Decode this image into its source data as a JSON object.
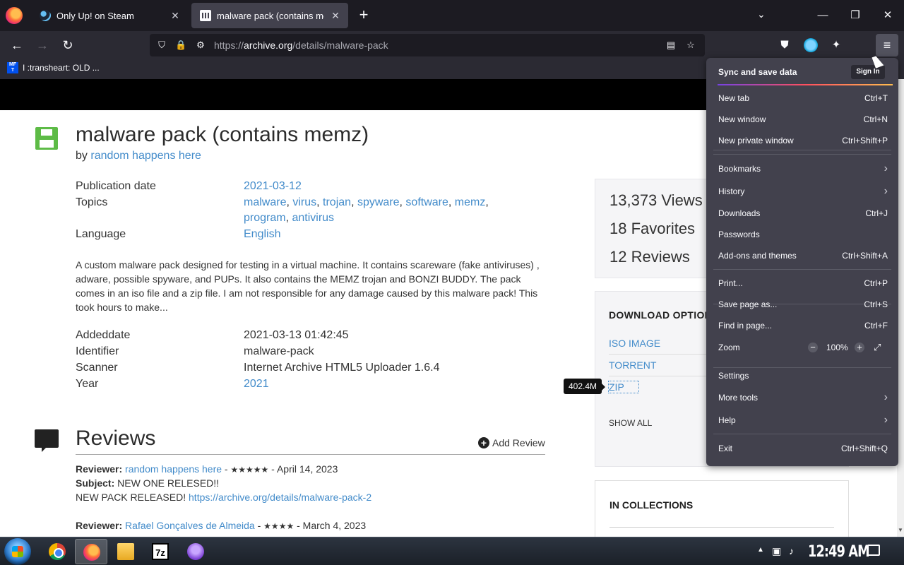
{
  "browser": {
    "tabs": [
      {
        "title": "Only Up! on Steam",
        "active": false
      },
      {
        "title": "malware pack (contains memz)",
        "active": true
      }
    ],
    "close_glyph": "✕",
    "url_prefix": "https://",
    "url_domain": "archive.org",
    "url_path": "/details/malware-pack",
    "bookmark": {
      "label": "I :transheart: OLD ...",
      "icon_text": "MF T"
    }
  },
  "item": {
    "title": "malware pack (contains memz)",
    "by_label": "by",
    "author": "random happens here",
    "publication_date_label": "Publication date",
    "publication_date": "2021-03-12",
    "topics_label": "Topics",
    "topics_line1": [
      {
        "text": "malware",
        "sep": ", "
      },
      {
        "text": "virus",
        "sep": ", "
      },
      {
        "text": "trojan",
        "sep": ", "
      },
      {
        "text": "spyware",
        "sep": ", "
      },
      {
        "text": "software",
        "sep": ", "
      },
      {
        "text": "memz",
        "sep": ","
      }
    ],
    "topics_line2": [
      {
        "text": "program",
        "sep": ", "
      },
      {
        "text": "antivirus",
        "sep": ""
      }
    ],
    "language_label": "Language",
    "language": "English",
    "description": "A custom malware pack designed for testing in a virtual machine. It contains scareware (fake antiviruses) , adware, possible spyware, and PUPs. It also contains the MEMZ trojan and BONZI BUDDY. The pack comes in an iso file and a zip file. I am not responsible for any damage caused by this malware pack! This took hours to make...",
    "addeddate_label": "Addeddate",
    "addeddate": "2021-03-13 01:42:45",
    "identifier_label": "Identifier",
    "identifier": "malware-pack",
    "scanner_label": "Scanner",
    "scanner": "Internet Archive HTML5 Uploader 1.6.4",
    "year_label": "Year",
    "year": "2021"
  },
  "reviews": {
    "heading": "Reviews",
    "add_label": "Add Review",
    "items": [
      {
        "reviewer_label": "Reviewer:",
        "reviewer": "random happens here",
        "stars": "★★★★★",
        "date": "April 14, 2023",
        "subject_label": "Subject:",
        "subject": "NEW ONE RELESED!!",
        "body_prefix": "NEW PACK RELEASED!",
        "body_link": "https://archive.org/details/malware-pack-2"
      },
      {
        "reviewer_label": "Reviewer:",
        "reviewer": "Rafael Gonçalves de Almeida",
        "stars": "★★★★",
        "date": "March 4, 2023"
      }
    ]
  },
  "stats": {
    "views": "13,373 Views",
    "favorites": "18 Favorites",
    "reviews": "12 Reviews"
  },
  "downloads": {
    "heading": "DOWNLOAD OPTIONS",
    "options": [
      "ISO IMAGE",
      "TORRENT",
      "ZIP"
    ],
    "show_all": "SHOW ALL",
    "tooltip": "402.4M"
  },
  "collections": {
    "heading": "IN COLLECTIONS"
  },
  "menu": {
    "sync_label": "Sync and save data",
    "sign_in": "Sign In",
    "items": [
      {
        "label": "New tab",
        "shortcut": "Ctrl+T"
      },
      {
        "label": "New window",
        "shortcut": "Ctrl+N"
      },
      {
        "label": "New private window",
        "shortcut": "Ctrl+Shift+P"
      },
      {
        "label": "Bookmarks",
        "submenu": true
      },
      {
        "label": "History",
        "submenu": true
      },
      {
        "label": "Downloads",
        "shortcut": "Ctrl+J"
      },
      {
        "label": "Passwords",
        "shortcut": ""
      },
      {
        "label": "Add-ons and themes",
        "shortcut": "Ctrl+Shift+A"
      },
      {
        "label": "Print...",
        "shortcut": "Ctrl+P"
      },
      {
        "label": "Save page as...",
        "shortcut": "Ctrl+S"
      },
      {
        "label": "Find in page...",
        "shortcut": "Ctrl+F"
      },
      {
        "label": "Settings",
        "shortcut": ""
      },
      {
        "label": "More tools",
        "submenu": true
      },
      {
        "label": "Help",
        "submenu": true
      },
      {
        "label": "Exit",
        "shortcut": "Ctrl+Shift+Q"
      }
    ],
    "zoom_label": "Zoom",
    "zoom_value": "100%"
  },
  "taskbar": {
    "clock": "12:49 AM"
  },
  "icons": {
    "back": "←",
    "forward": "→",
    "reload": "↻",
    "chevron": "›",
    "plus": "+",
    "minus": "−",
    "list_all_tabs": "⌄",
    "minimize": "—",
    "restore": "❐",
    "close_window": "✕",
    "shield": "⛉",
    "lock": "🔒",
    "permissions": "⚙",
    "reader": "▤",
    "star": "☆",
    "pocket": "⛊",
    "extensions": "✦",
    "menu": "≡",
    "fullscreen": "⤢",
    "scroll_down": "▼",
    "tray_up": "▲",
    "network": "▣",
    "volume": "♪"
  }
}
